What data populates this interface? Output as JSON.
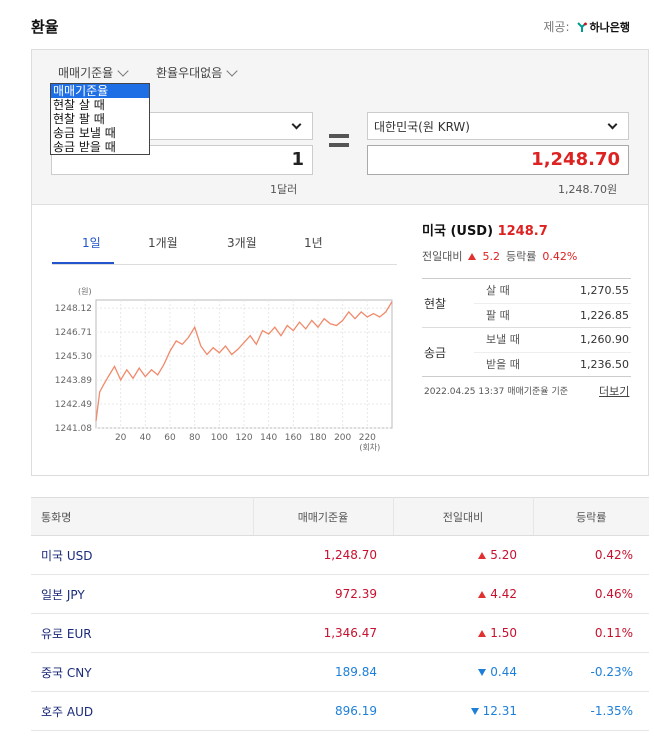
{
  "header": {
    "title": "환율",
    "provider_label": "제공:",
    "provider_name": "하나은행"
  },
  "converter": {
    "rate_type_toggle": "매매기준율",
    "preferential_toggle": "환율우대없음",
    "dropdown_options": [
      "매매기준율",
      "현찰 살 때",
      "현찰 팔 때",
      "송금 보낼 때",
      "송금 받을 때"
    ],
    "dropdown_selected_index": 0,
    "to_currency": "대한민국(원 KRW)",
    "from_amount": "1",
    "to_amount": "1,248.70",
    "from_note": "1달러",
    "to_note": "1,248.70원"
  },
  "tabs": [
    "1일",
    "1개월",
    "3개월",
    "1년"
  ],
  "active_tab": 0,
  "summary": {
    "country": "미국 (USD)",
    "rate": "1248.7",
    "change_label": "전일대비",
    "change_value": "5.2",
    "pct_label": "등락률",
    "pct_value": "0.42%"
  },
  "rate_groups": [
    {
      "label": "현찰",
      "rows": [
        {
          "label": "살 때",
          "value": "1,270.55"
        },
        {
          "label": "팔 때",
          "value": "1,226.85"
        }
      ]
    },
    {
      "label": "송금",
      "rows": [
        {
          "label": "보낼 때",
          "value": "1,260.90"
        },
        {
          "label": "받을 때",
          "value": "1,236.50"
        }
      ]
    }
  ],
  "timestamp": "2022.04.25 13:37  매매기준율 기준",
  "more_link": "더보기",
  "chart_data": {
    "type": "line",
    "yunit": "(원)",
    "xunit": "(회차)",
    "yticks": [
      1248.12,
      1246.71,
      1245.3,
      1243.89,
      1242.49,
      1241.08
    ],
    "xticks": [
      20,
      40,
      60,
      80,
      100,
      120,
      140,
      160,
      180,
      200,
      220
    ],
    "ylim": [
      1241.08,
      1248.6
    ],
    "xlim": [
      0,
      240
    ],
    "grid": true,
    "color": "#f08a6a",
    "x": [
      0,
      3,
      6,
      10,
      15,
      20,
      25,
      30,
      35,
      40,
      45,
      50,
      55,
      60,
      65,
      70,
      75,
      80,
      85,
      90,
      95,
      100,
      105,
      110,
      115,
      120,
      125,
      130,
      135,
      140,
      145,
      150,
      155,
      160,
      165,
      170,
      175,
      180,
      185,
      190,
      195,
      200,
      205,
      210,
      215,
      220,
      225,
      230,
      235,
      240
    ],
    "y": [
      1241.5,
      1243.2,
      1243.6,
      1244.1,
      1244.7,
      1243.9,
      1244.5,
      1244.0,
      1244.6,
      1244.1,
      1244.5,
      1244.2,
      1244.8,
      1245.6,
      1246.2,
      1246.0,
      1246.4,
      1247.0,
      1245.9,
      1245.4,
      1245.8,
      1245.5,
      1245.9,
      1245.4,
      1245.7,
      1246.1,
      1246.5,
      1246.0,
      1246.8,
      1246.6,
      1247.0,
      1246.5,
      1247.1,
      1246.8,
      1247.3,
      1246.9,
      1247.4,
      1247.0,
      1247.5,
      1247.2,
      1247.1,
      1247.4,
      1247.9,
      1247.5,
      1247.9,
      1247.6,
      1247.8,
      1247.6,
      1247.9,
      1248.5
    ]
  },
  "currency_table": {
    "headers": [
      "통화명",
      "매매기준율",
      "전일대비",
      "등락률"
    ],
    "rows": [
      {
        "name": "미국 USD",
        "rate": "1,248.70",
        "change": "5.20",
        "pct": "0.42%",
        "dir": "up"
      },
      {
        "name": "일본 JPY",
        "rate": "972.39",
        "change": "4.42",
        "pct": "0.46%",
        "dir": "up"
      },
      {
        "name": "유로 EUR",
        "rate": "1,346.47",
        "change": "1.50",
        "pct": "0.11%",
        "dir": "up"
      },
      {
        "name": "중국 CNY",
        "rate": "189.84",
        "change": "0.44",
        "pct": "-0.23%",
        "dir": "down"
      },
      {
        "name": "호주 AUD",
        "rate": "896.19",
        "change": "12.31",
        "pct": "-1.35%",
        "dir": "down"
      }
    ]
  }
}
